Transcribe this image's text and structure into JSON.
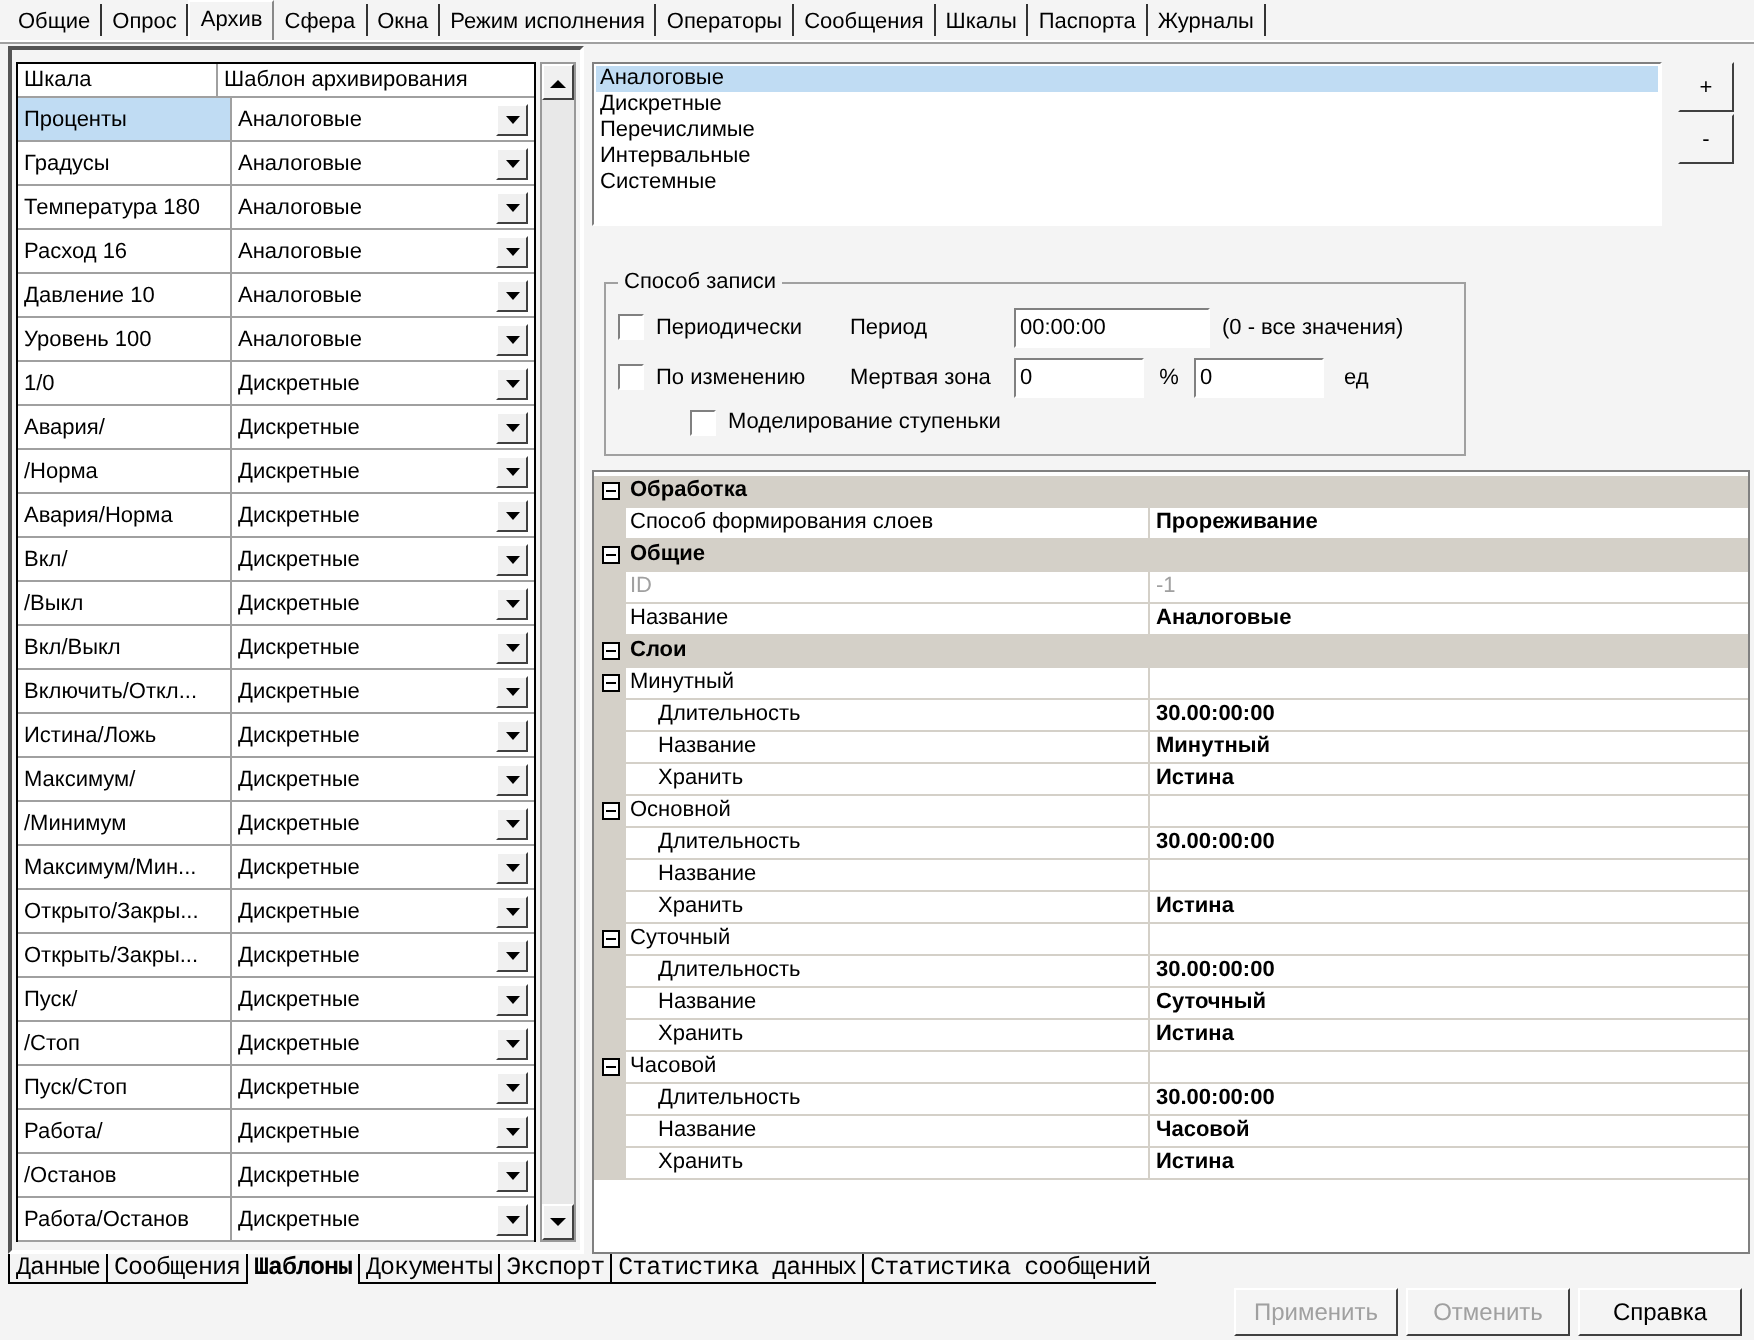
{
  "top_tabs": [
    {
      "label": "Общие",
      "selected": false
    },
    {
      "label": "Опрос",
      "selected": false
    },
    {
      "label": "Архив",
      "selected": true
    },
    {
      "label": "Сфера",
      "selected": false
    },
    {
      "label": "Окна",
      "selected": false
    },
    {
      "label": "Режим исполнения",
      "selected": false
    },
    {
      "label": "Операторы",
      "selected": false
    },
    {
      "label": "Сообщения",
      "selected": false
    },
    {
      "label": "Шкалы",
      "selected": false
    },
    {
      "label": "Паспорта",
      "selected": false
    },
    {
      "label": "Журналы",
      "selected": false
    }
  ],
  "scale_grid": {
    "columns": [
      "Шкала",
      "Шаблон архивирования"
    ],
    "rows": [
      {
        "scale": "Проценты",
        "template": "Аналоговые",
        "selected": true
      },
      {
        "scale": "Градусы",
        "template": "Аналоговые",
        "selected": false
      },
      {
        "scale": "Температура 180",
        "template": "Аналоговые",
        "selected": false
      },
      {
        "scale": "Расход 16",
        "template": "Аналоговые",
        "selected": false
      },
      {
        "scale": "Давление 10",
        "template": "Аналоговые",
        "selected": false
      },
      {
        "scale": "Уровень 100",
        "template": "Аналоговые",
        "selected": false
      },
      {
        "scale": "1/0",
        "template": "Дискретные",
        "selected": false
      },
      {
        "scale": "Авария/",
        "template": "Дискретные",
        "selected": false
      },
      {
        "scale": "/Норма",
        "template": "Дискретные",
        "selected": false
      },
      {
        "scale": "Авария/Норма",
        "template": "Дискретные",
        "selected": false
      },
      {
        "scale": "Вкл/",
        "template": "Дискретные",
        "selected": false
      },
      {
        "scale": "/Выкл",
        "template": "Дискретные",
        "selected": false
      },
      {
        "scale": "Вкл/Выкл",
        "template": "Дискретные",
        "selected": false
      },
      {
        "scale": "Включить/Откл...",
        "template": "Дискретные",
        "selected": false
      },
      {
        "scale": "Истина/Ложь",
        "template": "Дискретные",
        "selected": false
      },
      {
        "scale": "Максимум/",
        "template": "Дискретные",
        "selected": false
      },
      {
        "scale": "/Минимум",
        "template": "Дискретные",
        "selected": false
      },
      {
        "scale": "Максимум/Мин...",
        "template": "Дискретные",
        "selected": false
      },
      {
        "scale": "Открыто/Закры...",
        "template": "Дискретные",
        "selected": false
      },
      {
        "scale": "Открыть/Закры...",
        "template": "Дискретные",
        "selected": false
      },
      {
        "scale": "Пуск/",
        "template": "Дискретные",
        "selected": false
      },
      {
        "scale": "/Стоп",
        "template": "Дискретные",
        "selected": false
      },
      {
        "scale": "Пуск/Стоп",
        "template": "Дискретные",
        "selected": false
      },
      {
        "scale": "Работа/",
        "template": "Дискретные",
        "selected": false
      },
      {
        "scale": "/Останов",
        "template": "Дискретные",
        "selected": false
      },
      {
        "scale": "Работа/Останов",
        "template": "Дискретные",
        "selected": false
      }
    ]
  },
  "template_list": [
    {
      "label": "Аналоговые",
      "selected": true
    },
    {
      "label": "Дискретные",
      "selected": false
    },
    {
      "label": "Перечислимые",
      "selected": false
    },
    {
      "label": "Интервальные",
      "selected": false
    },
    {
      "label": "Системные",
      "selected": false
    }
  ],
  "list_buttons": [
    "+",
    "-"
  ],
  "record_group": {
    "title": "Способ записи",
    "periodic": {
      "label": "Периодически",
      "checked": false
    },
    "period_label": "Период",
    "period": "00:00:00",
    "period_hint": "(0 - все значения)",
    "on_change": {
      "label": "По изменению",
      "checked": false
    },
    "deadzone_label": "Мертвая зона",
    "deadzone_percent": "0",
    "percent_sign": "%",
    "deadzone_units": "0",
    "units_label": "ед",
    "step": {
      "label": "Моделирование ступеньки",
      "checked": false
    }
  },
  "property_grid": [
    {
      "kind": "category",
      "label": "Обработка",
      "expanded": true,
      "children": [
        {
          "kind": "property",
          "label": "Способ формирования слоев",
          "value": "Прореживание",
          "disabled": false
        }
      ]
    },
    {
      "kind": "category",
      "label": "Общие",
      "expanded": true,
      "children": [
        {
          "kind": "property",
          "label": "ID",
          "value": "-1",
          "disabled": true
        },
        {
          "kind": "property",
          "label": "Название",
          "value": "Аналоговые",
          "disabled": false
        }
      ]
    },
    {
      "kind": "category",
      "label": "Слои",
      "expanded": true,
      "children": [
        {
          "kind": "group",
          "label": "Минутный",
          "expanded": true,
          "children": [
            {
              "kind": "property",
              "label": "Длительность",
              "value": "30.00:00:00",
              "disabled": false
            },
            {
              "kind": "property",
              "label": "Название",
              "value": "Минутный",
              "disabled": false
            },
            {
              "kind": "property",
              "label": "Хранить",
              "value": "Истина",
              "disabled": false
            }
          ]
        },
        {
          "kind": "group",
          "label": "Основной",
          "expanded": true,
          "children": [
            {
              "kind": "property",
              "label": "Длительность",
              "value": "30.00:00:00",
              "disabled": false
            },
            {
              "kind": "property",
              "label": "Название",
              "disabled": false
            },
            {
              "kind": "property",
              "label": "Хранить",
              "value": "Истина",
              "disabled": false
            }
          ]
        },
        {
          "kind": "group",
          "label": "Суточный",
          "expanded": true,
          "children": [
            {
              "kind": "property",
              "label": "Длительность",
              "value": "30.00:00:00",
              "disabled": false
            },
            {
              "kind": "property",
              "label": "Название",
              "value": "Суточный",
              "disabled": false
            },
            {
              "kind": "property",
              "label": "Хранить",
              "value": "Истина",
              "disabled": false
            }
          ]
        },
        {
          "kind": "group",
          "label": "Часовой",
          "expanded": true,
          "children": [
            {
              "kind": "property",
              "label": "Длительность",
              "value": "30.00:00:00",
              "disabled": false
            },
            {
              "kind": "property",
              "label": "Название",
              "value": "Часовой",
              "disabled": false
            },
            {
              "kind": "property",
              "label": "Хранить",
              "value": "Истина",
              "disabled": false
            }
          ]
        }
      ]
    }
  ],
  "bottom_tabs": [
    {
      "label": "Данные",
      "selected": false
    },
    {
      "label": "Сообщения",
      "selected": false
    },
    {
      "label": "Шаблоны",
      "selected": true
    },
    {
      "label": "Документы",
      "selected": false
    },
    {
      "label": "Экспорт",
      "selected": false
    },
    {
      "label": "Статистика данных",
      "selected": false
    },
    {
      "label": "Статистика сообщений",
      "selected": false
    }
  ],
  "footer_buttons": [
    {
      "label": "Применить",
      "disabled": true
    },
    {
      "label": "Отменить",
      "disabled": true
    },
    {
      "label": "Справка",
      "disabled": false
    }
  ]
}
